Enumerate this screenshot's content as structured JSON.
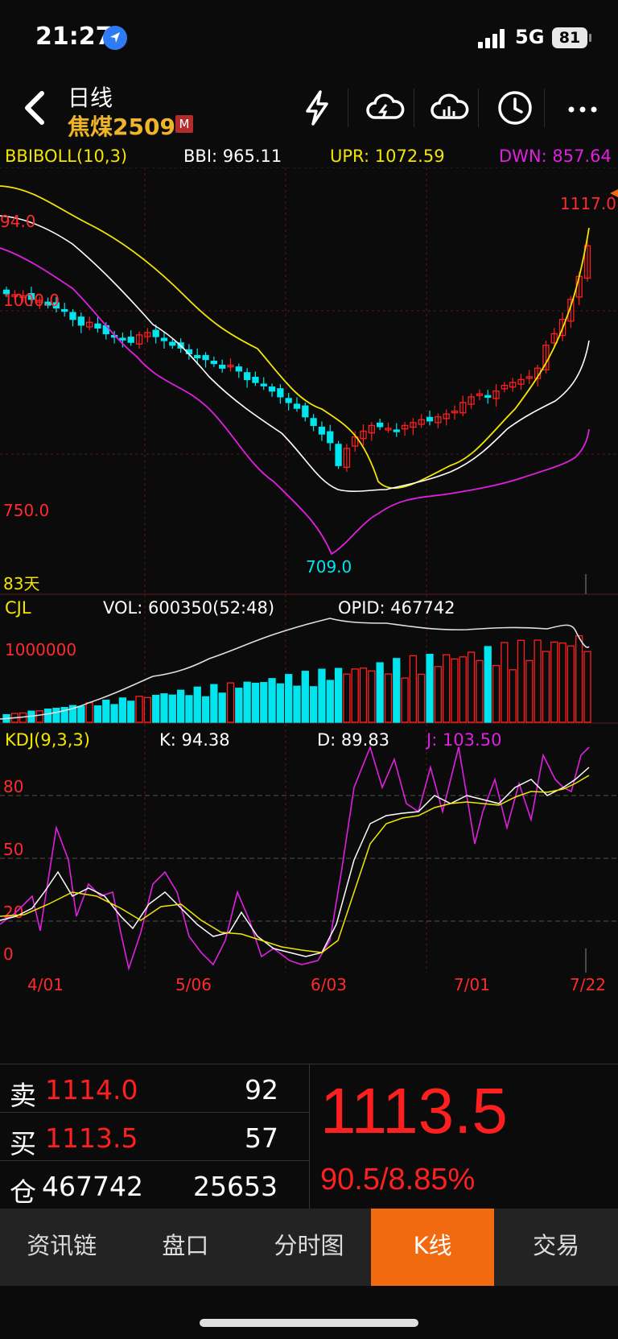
{
  "status": {
    "time": "21:27",
    "network": "5G",
    "battery": "81"
  },
  "nav": {
    "title": "日线",
    "symbol": "焦煤2509",
    "tag": "M"
  },
  "boll": {
    "name": "BBIBOLL(10,3)",
    "bbi": "BBI: 965.11",
    "upr": "UPR: 1072.59",
    "dwn": "DWN: 857.64"
  },
  "vol": {
    "name": "CJL",
    "vol": "VOL: 600350(52:48)",
    "opid": "OPID: 467742"
  },
  "kdj": {
    "name": "KDJ(9,3,3)",
    "k": "K: 94.38",
    "d": "D: 89.83",
    "j": "J: 103.50"
  },
  "chart_labels": {
    "price_top": "94.0",
    "price_1000": "1000.0",
    "price_750": "750.0",
    "high": "1117.0",
    "low": "709.0",
    "days": "83天",
    "vol_1000000": "1000000",
    "kdj_80": "80",
    "kdj_50": "50",
    "kdj_20": "20",
    "kdj_0": "0"
  },
  "dates": [
    "4/01",
    "5/06",
    "6/03",
    "7/01",
    "7/22"
  ],
  "quote": {
    "sell_label": "卖",
    "sell_price": "1114.0",
    "sell_qty": "92",
    "buy_label": "买",
    "buy_price": "1113.5",
    "buy_qty": "57",
    "oi_label": "仓",
    "oi": "467742",
    "oi_change": "25653",
    "last": "1113.5",
    "change": "90.5/8.85%"
  },
  "tabs": [
    "资讯链",
    "盘口",
    "分时图",
    "K线",
    "交易"
  ],
  "colors": {
    "up": "#ff1f1f",
    "down": "#00e5ee",
    "accent": "#f26a0f",
    "upr": "#f2e600",
    "dwn": "#e020e0"
  },
  "chart_data": {
    "type": "candlestick",
    "close_series": [
      1030,
      1028,
      1026,
      1020,
      1018,
      1010,
      1005,
      1000,
      985,
      975,
      980,
      970,
      960,
      955,
      950,
      945,
      958,
      962,
      955,
      948,
      940,
      935,
      925,
      918,
      915,
      908,
      900,
      905,
      895,
      880,
      875,
      870,
      860,
      850,
      840,
      830,
      815,
      800,
      785,
      770,
      730,
      760,
      780,
      790,
      800,
      798,
      795,
      790,
      800,
      805,
      810,
      808,
      815,
      820,
      825,
      840,
      850,
      855,
      850,
      860,
      870,
      875,
      880,
      885,
      900,
      940,
      960,
      985,
      1020,
      1060,
      1113.5
    ],
    "high": 1117.0,
    "low": 709.0
  }
}
